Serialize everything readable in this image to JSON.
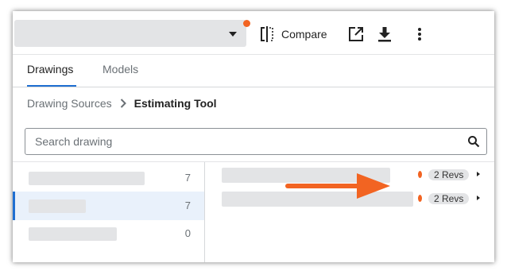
{
  "toolbar": {
    "drawing_select_value": "",
    "compare_label": "Compare",
    "accent_color": "#f26422"
  },
  "tabs": [
    {
      "label": "Drawings",
      "active": true
    },
    {
      "label": "Models",
      "active": false
    }
  ],
  "breadcrumb": {
    "parent": "Drawing Sources",
    "current": "Estimating Tool"
  },
  "search": {
    "placeholder": "Search drawing",
    "value": ""
  },
  "sources": [
    {
      "name": "",
      "count": "7",
      "selected": false
    },
    {
      "name": "",
      "count": "7",
      "selected": true
    },
    {
      "name": "",
      "count": "0",
      "selected": false
    }
  ],
  "drawings": [
    {
      "name": "",
      "revisions": "2 Revs"
    },
    {
      "name": "",
      "revisions": "2 Revs"
    }
  ],
  "icons": {
    "compare": "split-compare-icon",
    "open_external": "open-external-icon",
    "download": "download-icon",
    "more": "more-vertical-icon",
    "search": "search-icon"
  },
  "colors": {
    "active_tab": "#1f6fd1",
    "selected_row": "#e9f1fb",
    "placeholder": "#e3e4e6",
    "arrow": "#f26422"
  }
}
